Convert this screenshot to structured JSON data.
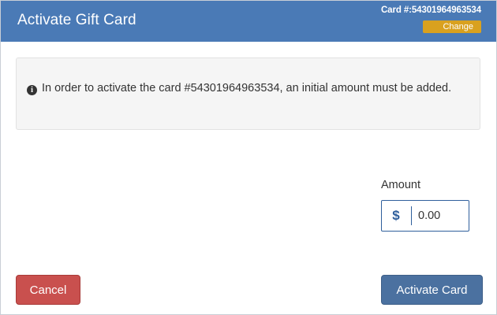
{
  "header": {
    "title": "Activate Gift Card",
    "card_number": "Card #:54301964963534",
    "change_label": "Change"
  },
  "info": {
    "icon": "info-circle-icon",
    "message": "In order to activate the card #54301964963534, an initial amount must be added."
  },
  "amount": {
    "label": "Amount",
    "currency_symbol": "$",
    "value": "0.00"
  },
  "footer": {
    "cancel_label": "Cancel",
    "activate_label": "Activate Card"
  },
  "colors": {
    "header_bg": "#4a7ab6",
    "change_bg": "#d9a11f",
    "cancel_bg": "#c9504e",
    "activate_bg": "#4b71a0",
    "input_border": "#2f5f9c"
  }
}
